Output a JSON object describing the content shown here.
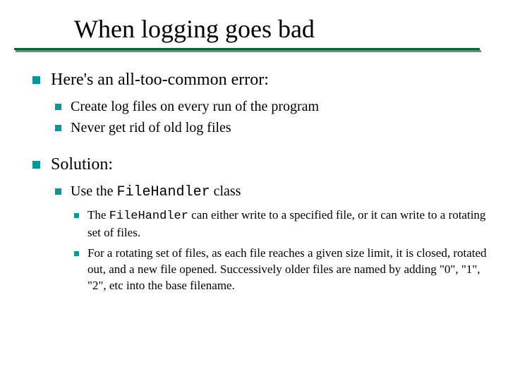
{
  "title": "When logging goes bad",
  "points": [
    {
      "text": "Here's an all-too-common error:",
      "sub": [
        {
          "text": "Create log files on every run of the program"
        },
        {
          "text": "Never get rid of old log files"
        }
      ]
    },
    {
      "text": "Solution:",
      "sub": [
        {
          "text_prefix": "Use the ",
          "code": "FileHandler",
          "text_suffix": " class",
          "sub": [
            {
              "text_prefix": " The ",
              "code": "FileHandler",
              "text_suffix": " can either write to a specified file, or it can write to a rotating set of files."
            },
            {
              "text": "For a rotating set of files, as each file reaches a given size limit, it is closed, rotated out, and a new file opened. Successively older files are named by adding \"0\", \"1\", \"2\", etc into the base filename."
            }
          ]
        }
      ]
    }
  ]
}
